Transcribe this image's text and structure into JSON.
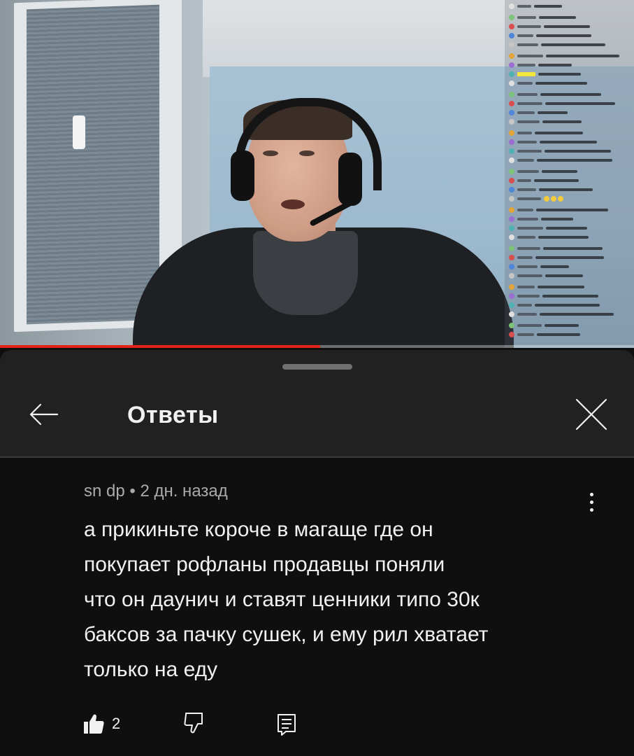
{
  "video": {
    "progress_fraction": 0.505,
    "progress_color": "#e62117",
    "chat_highlight_color": "#f3e73c"
  },
  "sheet": {
    "title": "Ответы",
    "back_icon": "arrow-left-icon",
    "close_icon": "close-icon"
  },
  "comment": {
    "author": "sn dp",
    "separator": "•",
    "time": "2 дн. назад",
    "meta": "sn dp • 2 дн. назад",
    "lines": [
      "а прикиньте короче в магаще где он",
      "покупает рофланы продавцы поняли",
      "что он даунич и ставят ценники типо 30к",
      "баксов за пачку сушек, и ему рил хватает",
      "только на еду"
    ],
    "like_count": "2",
    "icons": {
      "like": "thumbs-up-icon",
      "dislike": "thumbs-down-icon",
      "reply": "reply-icon",
      "more": "more-vertical-icon"
    }
  }
}
